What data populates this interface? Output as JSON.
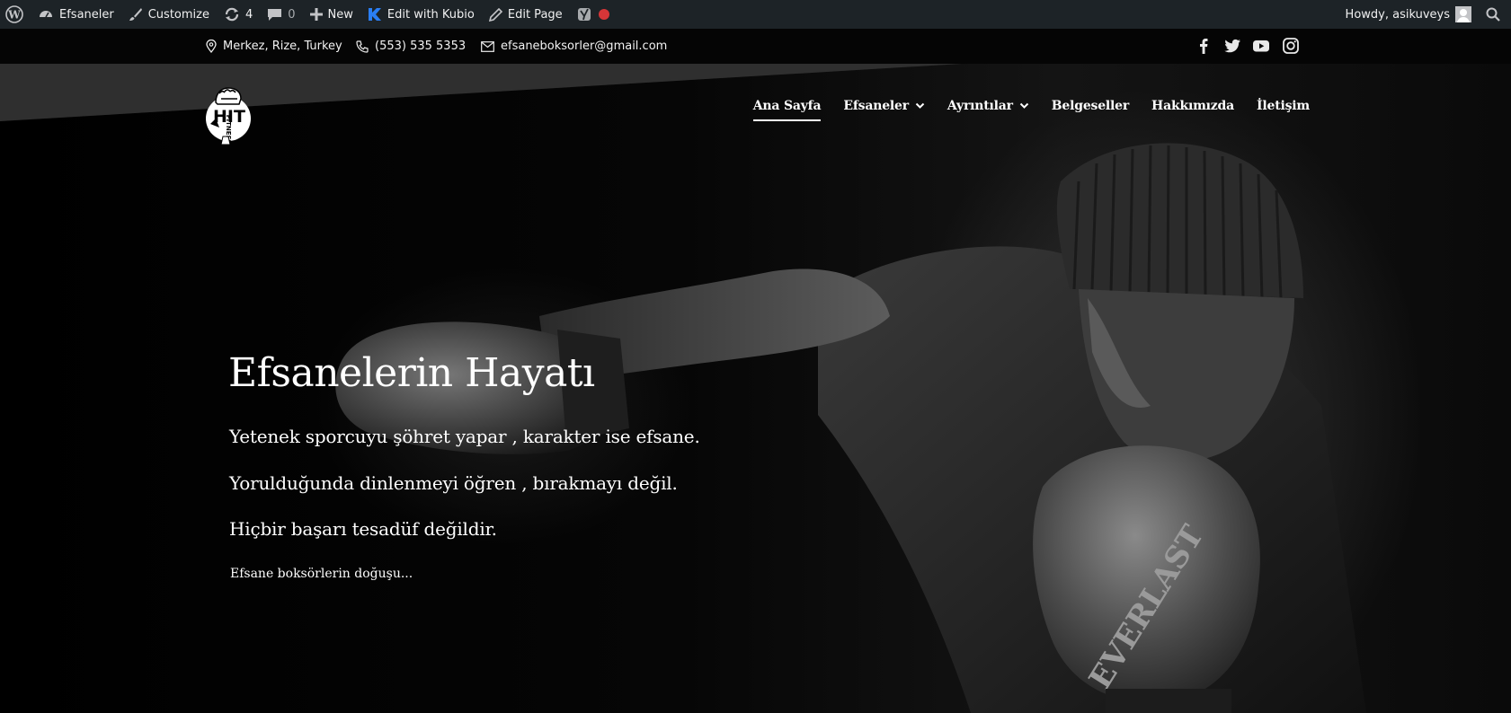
{
  "adminbar": {
    "site_name": "Efsaneler",
    "customize": "Customize",
    "updates_count": "4",
    "comments_count": "0",
    "new_label": "New",
    "kubio_label": "Edit with Kubio",
    "edit_page_label": "Edit Page",
    "howdy": "Howdy, asikuveys",
    "colors": {
      "bg": "#1d2327",
      "text": "#f0f0f1",
      "kubio": "#2a7ef5",
      "record": "#d63638"
    }
  },
  "topbar": {
    "location": "Merkez, Rize, Turkey",
    "phone": "(553) 535 5353",
    "email": "efsaneboksorler@gmail.com",
    "social_icons": [
      "facebook-icon",
      "twitter-icon",
      "youtube-icon",
      "instagram-icon"
    ]
  },
  "logo": {
    "icon": "hit-fitness-fist-logo"
  },
  "nav": {
    "items": [
      {
        "label": "Ana Sayfa",
        "active": true,
        "dropdown": false
      },
      {
        "label": "Efsaneler",
        "active": false,
        "dropdown": true
      },
      {
        "label": "Ayrıntılar",
        "active": false,
        "dropdown": true
      },
      {
        "label": "Belgeseller",
        "active": false,
        "dropdown": false
      },
      {
        "label": "Hakkımızda",
        "active": false,
        "dropdown": false
      },
      {
        "label": "İletişim",
        "active": false,
        "dropdown": false
      }
    ]
  },
  "hero": {
    "title": "Efsanelerin Hayatı",
    "lines": [
      "Yetenek sporcuyu şöhret yapar , karakter ise efsane.",
      "Yorulduğunda dinlenmeyi öğren , bırakmayı değil.",
      "Hiçbir başarı tesadüf değildir."
    ],
    "link": "Efsane boksörlerin doğuşu..."
  }
}
